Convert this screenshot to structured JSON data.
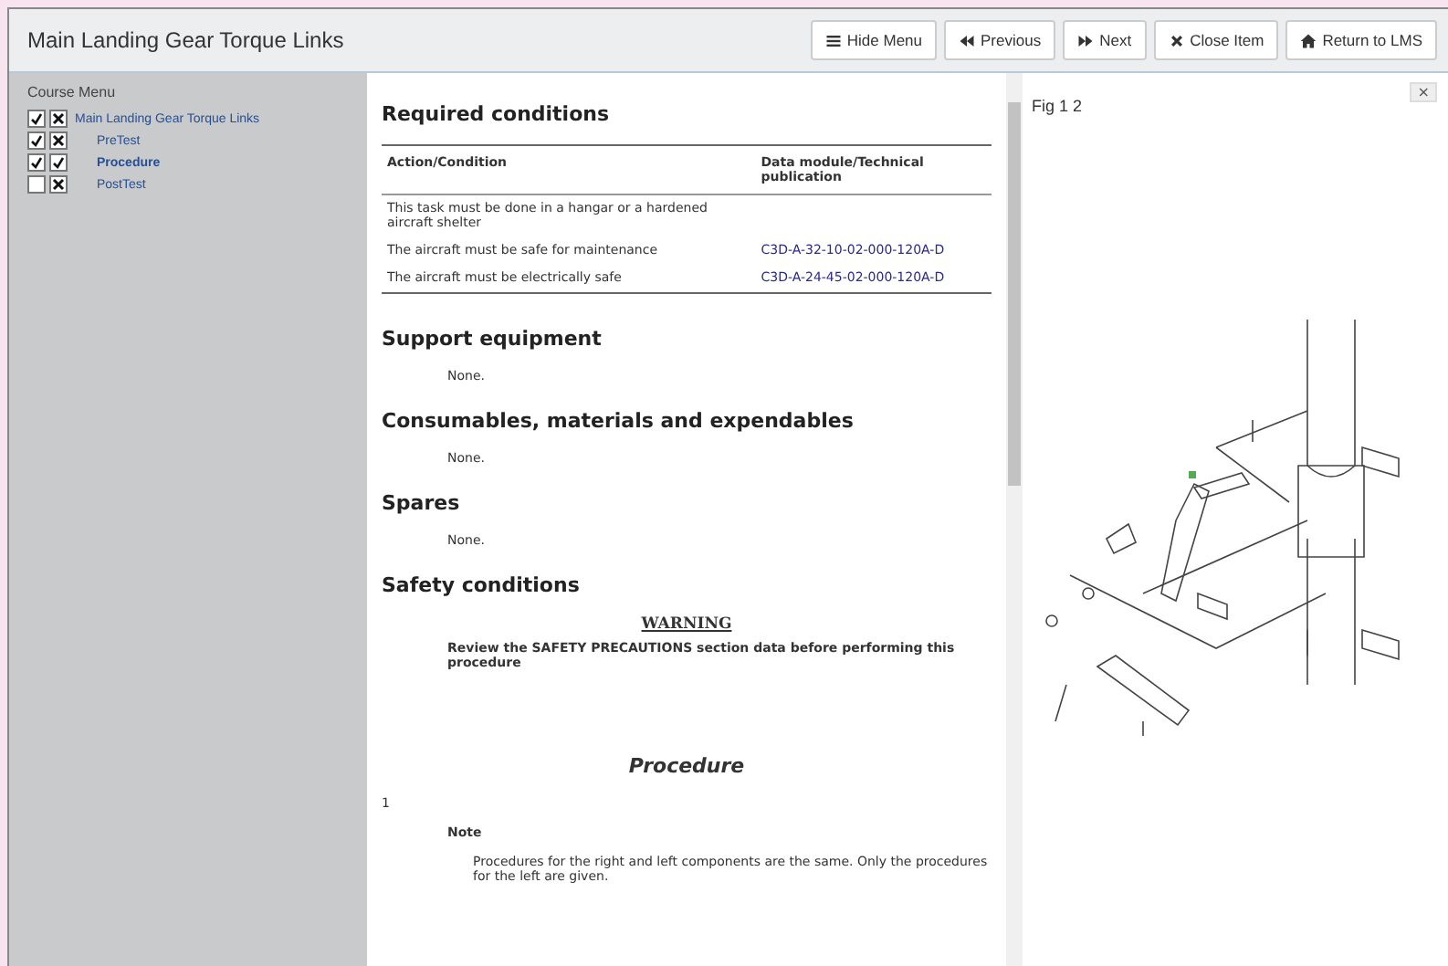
{
  "window": {
    "title": "Main Landing Gear Torque Links"
  },
  "toolbar": [
    {
      "label": "Hide Menu",
      "kind": "menu"
    },
    {
      "label": "Previous",
      "kind": "previous"
    },
    {
      "label": "Next",
      "kind": "next"
    },
    {
      "label": "Close Item",
      "kind": "close"
    },
    {
      "label": "Return to LMS",
      "kind": "home"
    }
  ],
  "sidebar": {
    "title": "Course Menu",
    "items": [
      {
        "label": "Main Landing Gear Torque Links",
        "completed": true,
        "passed": false,
        "children": [
          {
            "label": "PreTest",
            "completed": true,
            "passed": false
          },
          {
            "label": "Procedure",
            "completed": true,
            "passed": true,
            "selected": true
          },
          {
            "label": "PostTest",
            "completed": false,
            "passed": false,
            "selected": false
          }
        ]
      }
    ]
  },
  "content": {
    "required_conditions": {
      "heading": "Required conditions",
      "columns": [
        "Action/Condition",
        "Data module/Technical publication"
      ],
      "rows": [
        {
          "action": "This task must be done in a hangar or a hardened aircraft shelter",
          "reference": ""
        },
        {
          "action": "The aircraft must be safe for maintenance",
          "reference": "C3D-A-32-10-02-000-120A-D"
        },
        {
          "action": "The aircraft must be electrically safe",
          "reference": "C3D-A-24-45-02-000-120A-D"
        }
      ]
    },
    "sections": [
      {
        "heading": "Support equipment",
        "text": "None."
      },
      {
        "heading": "Consumables, materials and expendables",
        "text": "None."
      },
      {
        "heading": "Spares",
        "text": "None."
      }
    ],
    "safety": {
      "heading": "Safety conditions",
      "warning_title": "WARNING",
      "warning_text": "Review the SAFETY PRECAUTIONS section data before performing this procedure"
    },
    "procedure": {
      "heading": "Procedure",
      "step": "1",
      "note_title": "Note",
      "note_text": "Procedures for the right and left components are the same. Only the procedures for the left are given."
    }
  },
  "figure": {
    "title": "Fig 1 2",
    "close": "×"
  }
}
